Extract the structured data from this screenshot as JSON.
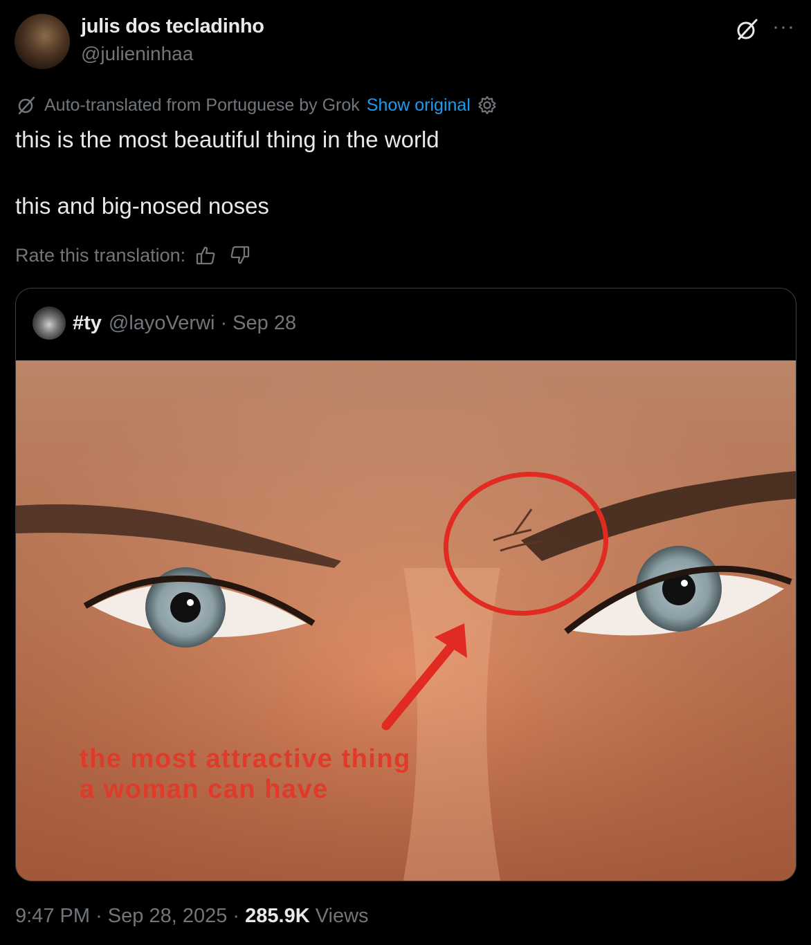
{
  "author": {
    "display_name": "julis dos tecladinho",
    "handle": "@julieninhaa"
  },
  "header_icons": {
    "grok": "grok-translate-icon",
    "more": "···"
  },
  "translation": {
    "notice": "Auto-translated from Portuguese by Grok",
    "show_original": "Show original",
    "rate_label": "Rate this translation:"
  },
  "tweet": {
    "line1": "this is the most beautiful thing in the world",
    "line2": "this and big-nosed noses"
  },
  "quote": {
    "name": "#ty",
    "handle": "@layoVerwi",
    "separator": "·",
    "date": "Sep 28",
    "image_caption_line1": "the most attractive thing",
    "image_caption_line2": "a woman can have"
  },
  "footer": {
    "time": "9:47 PM",
    "sep1": "·",
    "date": "Sep 28, 2025",
    "sep2": "·",
    "views_count": "285.9K",
    "views_label": "Views"
  },
  "colors": {
    "background": "#000000",
    "text": "#e7e9ea",
    "muted": "#71767b",
    "link": "#1d9bf0",
    "caption_red": "#e03a2a"
  }
}
